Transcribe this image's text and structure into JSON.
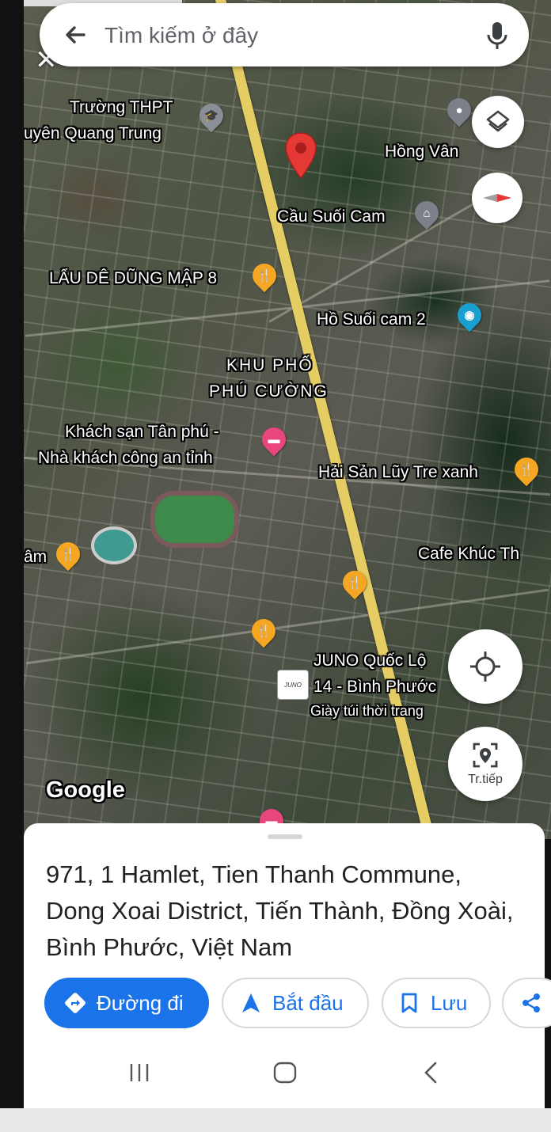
{
  "search": {
    "placeholder": "Tìm kiếm ở đây"
  },
  "map": {
    "places": {
      "school_line1": "Trường THPT",
      "school_line2": "uyên Quang Trung",
      "hong_van": "Hồng Vân",
      "bridge": "Cầu Suối Cam",
      "restaurant_lau_de": "LẨU DÊ DŨNG MẬP 8",
      "lake": "Hồ Suối cam 2",
      "district_line1": "KHU PHỐ",
      "district_line2": "PHÚ CƯỜNG",
      "hotel_line1": "Khách sạn Tân phú -",
      "hotel_line2": "Nhà khách công an tỉnh",
      "seafood": "Hải Sản Lũy Tre xanh",
      "restaurant_am": "âm",
      "cafe": "Cafe Khúc Th",
      "juno_line1": "JUNO Quốc Lộ",
      "juno_line2": "14 - Bình Phước",
      "juno_sub": "Giày túi thời trang",
      "juno_logo": "JUNO"
    },
    "watermark": "Google",
    "controls": {
      "live_view_label": "Tr.tiếp"
    }
  },
  "sheet": {
    "address": "971, 1 Hamlet, Tien Thanh Commune, Dong Xoai District, Tiến Thành, Đồng Xoài, Bình Phước, Việt Nam",
    "actions": {
      "directions": "Đường đi",
      "start": "Bắt đầu",
      "save": "Lưu"
    }
  },
  "colors": {
    "accent": "#1a73e8",
    "pin_red": "#e53935",
    "food_pin": "#f5a623",
    "highway": "#e6cd63"
  },
  "icons": {
    "back": "arrow-left-icon",
    "mic": "microphone-icon",
    "layers": "layers-icon",
    "compass": "compass-icon",
    "location": "my-location-icon",
    "live_view": "live-view-icon",
    "share": "share-icon"
  }
}
